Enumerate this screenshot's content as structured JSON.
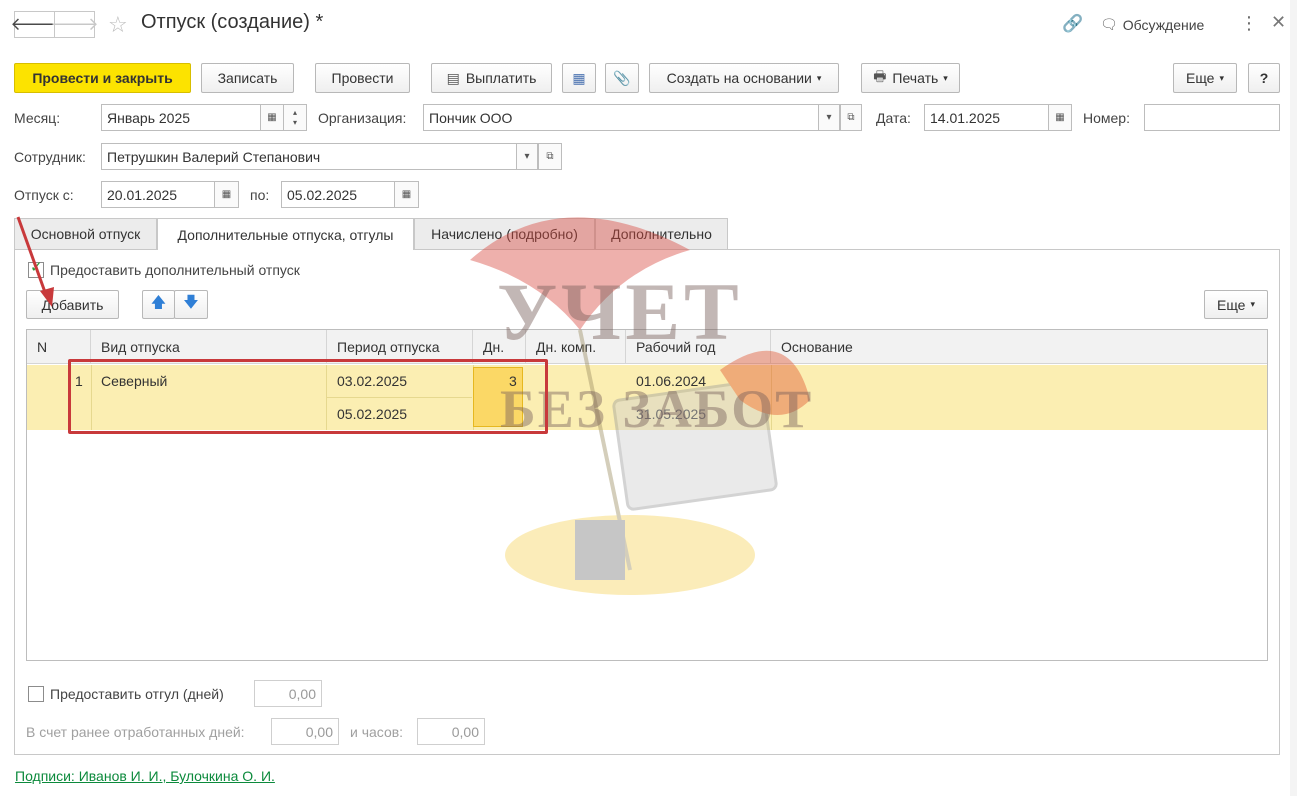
{
  "window": {
    "title": "Отпуск (создание) *",
    "discussion_label": "Обсуждение"
  },
  "toolbar": {
    "post_and_close": "Провести и закрыть",
    "save": "Записать",
    "post": "Провести",
    "pay": "Выплатить",
    "create_based_on": "Создать на основании",
    "print": "Печать",
    "more": "Еще",
    "help": "?"
  },
  "header": {
    "month_label": "Месяц:",
    "month_value": "Январь 2025",
    "organization_label": "Организация:",
    "organization_value": "Пончик ООО",
    "date_label": "Дата:",
    "date_value": "14.01.2025",
    "number_label": "Номер:",
    "number_value": "",
    "employee_label": "Сотрудник:",
    "employee_value": "Петрушкин Валерий Степанович",
    "vacation_from_label": "Отпуск с:",
    "vacation_from_value": "20.01.2025",
    "vacation_to_label": "по:",
    "vacation_to_value": "05.02.2025"
  },
  "tabs": [
    {
      "label": "Основной отпуск"
    },
    {
      "label": "Дополнительные отпуска, отгулы"
    },
    {
      "label": "Начислено (подробно)"
    },
    {
      "label": "Дополнительно"
    }
  ],
  "additional": {
    "provide_additional_label": "Предоставить дополнительный отпуск",
    "provide_additional_checked": true,
    "add_button": "Добавить",
    "more_button": "Еще",
    "columns": [
      "N",
      "Вид отпуска",
      "Период отпуска",
      "Дн.",
      "Дн. комп.",
      "Рабочий год",
      "Основание"
    ],
    "rows": [
      {
        "n": "1",
        "type": "Северный",
        "period_start": "03.02.2025",
        "period_end": "05.02.2025",
        "days": "3",
        "comp_days": "",
        "work_year_start": "01.06.2024",
        "work_year_end": "31.05.2025",
        "basis": ""
      }
    ],
    "time_off_label": "Предоставить отгул (дней)",
    "time_off_value": "0,00",
    "worked_days_label": "В счет ранее отработанных дней:",
    "worked_days_value": "0,00",
    "hours_label": "и часов:",
    "hours_value": "0,00"
  },
  "footer": {
    "signatures_link": "Подписи: Иванов И. И., Булочкина О. И."
  },
  "watermark": {
    "line1": "УЧЕТ",
    "line2": "БЕЗ ЗАБОТ"
  },
  "colors": {
    "primary_button": "#fce300",
    "selected_row": "#fbeeb2",
    "annotation": "#c8393b",
    "link": "#0c8a3c"
  }
}
